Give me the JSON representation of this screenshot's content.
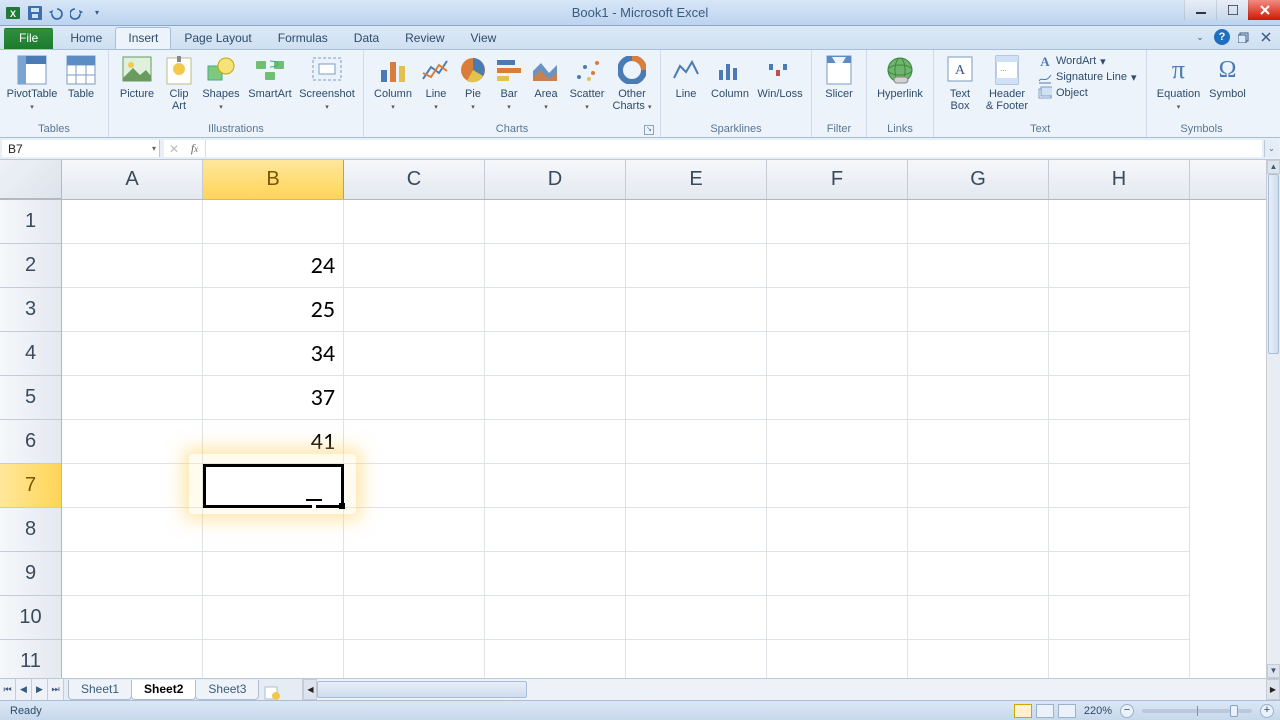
{
  "title": "Book1 - Microsoft Excel",
  "tabs": {
    "file": "File",
    "home": "Home",
    "insert": "Insert",
    "page_layout": "Page Layout",
    "formulas": "Formulas",
    "data": "Data",
    "review": "Review",
    "view": "View"
  },
  "ribbon": {
    "tables": {
      "pivot": "PivotTable",
      "table": "Table",
      "label": "Tables"
    },
    "illus": {
      "picture": "Picture",
      "clipart": "Clip\nArt",
      "shapes": "Shapes",
      "smartart": "SmartArt",
      "screenshot": "Screenshot",
      "label": "Illustrations"
    },
    "charts": {
      "column": "Column",
      "line": "Line",
      "pie": "Pie",
      "bar": "Bar",
      "area": "Area",
      "scatter": "Scatter",
      "other": "Other\nCharts",
      "label": "Charts"
    },
    "spark": {
      "line": "Line",
      "column": "Column",
      "winloss": "Win/Loss",
      "label": "Sparklines"
    },
    "filter": {
      "slicer": "Slicer",
      "label": "Filter"
    },
    "links": {
      "hyperlink": "Hyperlink",
      "label": "Links"
    },
    "text": {
      "textbox": "Text\nBox",
      "headerfooter": "Header\n& Footer",
      "wordart": "WordArt",
      "sigline": "Signature Line",
      "object": "Object",
      "label": "Text"
    },
    "symbols": {
      "equation": "Equation",
      "symbol": "Symbol",
      "label": "Symbols"
    }
  },
  "namebox": "B7",
  "columns": [
    "A",
    "B",
    "C",
    "D",
    "E",
    "F",
    "G",
    "H"
  ],
  "rows": [
    "1",
    "2",
    "3",
    "4",
    "5",
    "6",
    "7",
    "8",
    "9",
    "10",
    "11"
  ],
  "selected_col": "B",
  "selected_row": "7",
  "cell_data": {
    "B2": "24",
    "B3": "25",
    "B4": "34",
    "B5": "37",
    "B6": "41"
  },
  "sheets": {
    "s1": "Sheet1",
    "s2": "Sheet2",
    "s3": "Sheet3"
  },
  "status": {
    "ready": "Ready",
    "zoom": "220%"
  }
}
